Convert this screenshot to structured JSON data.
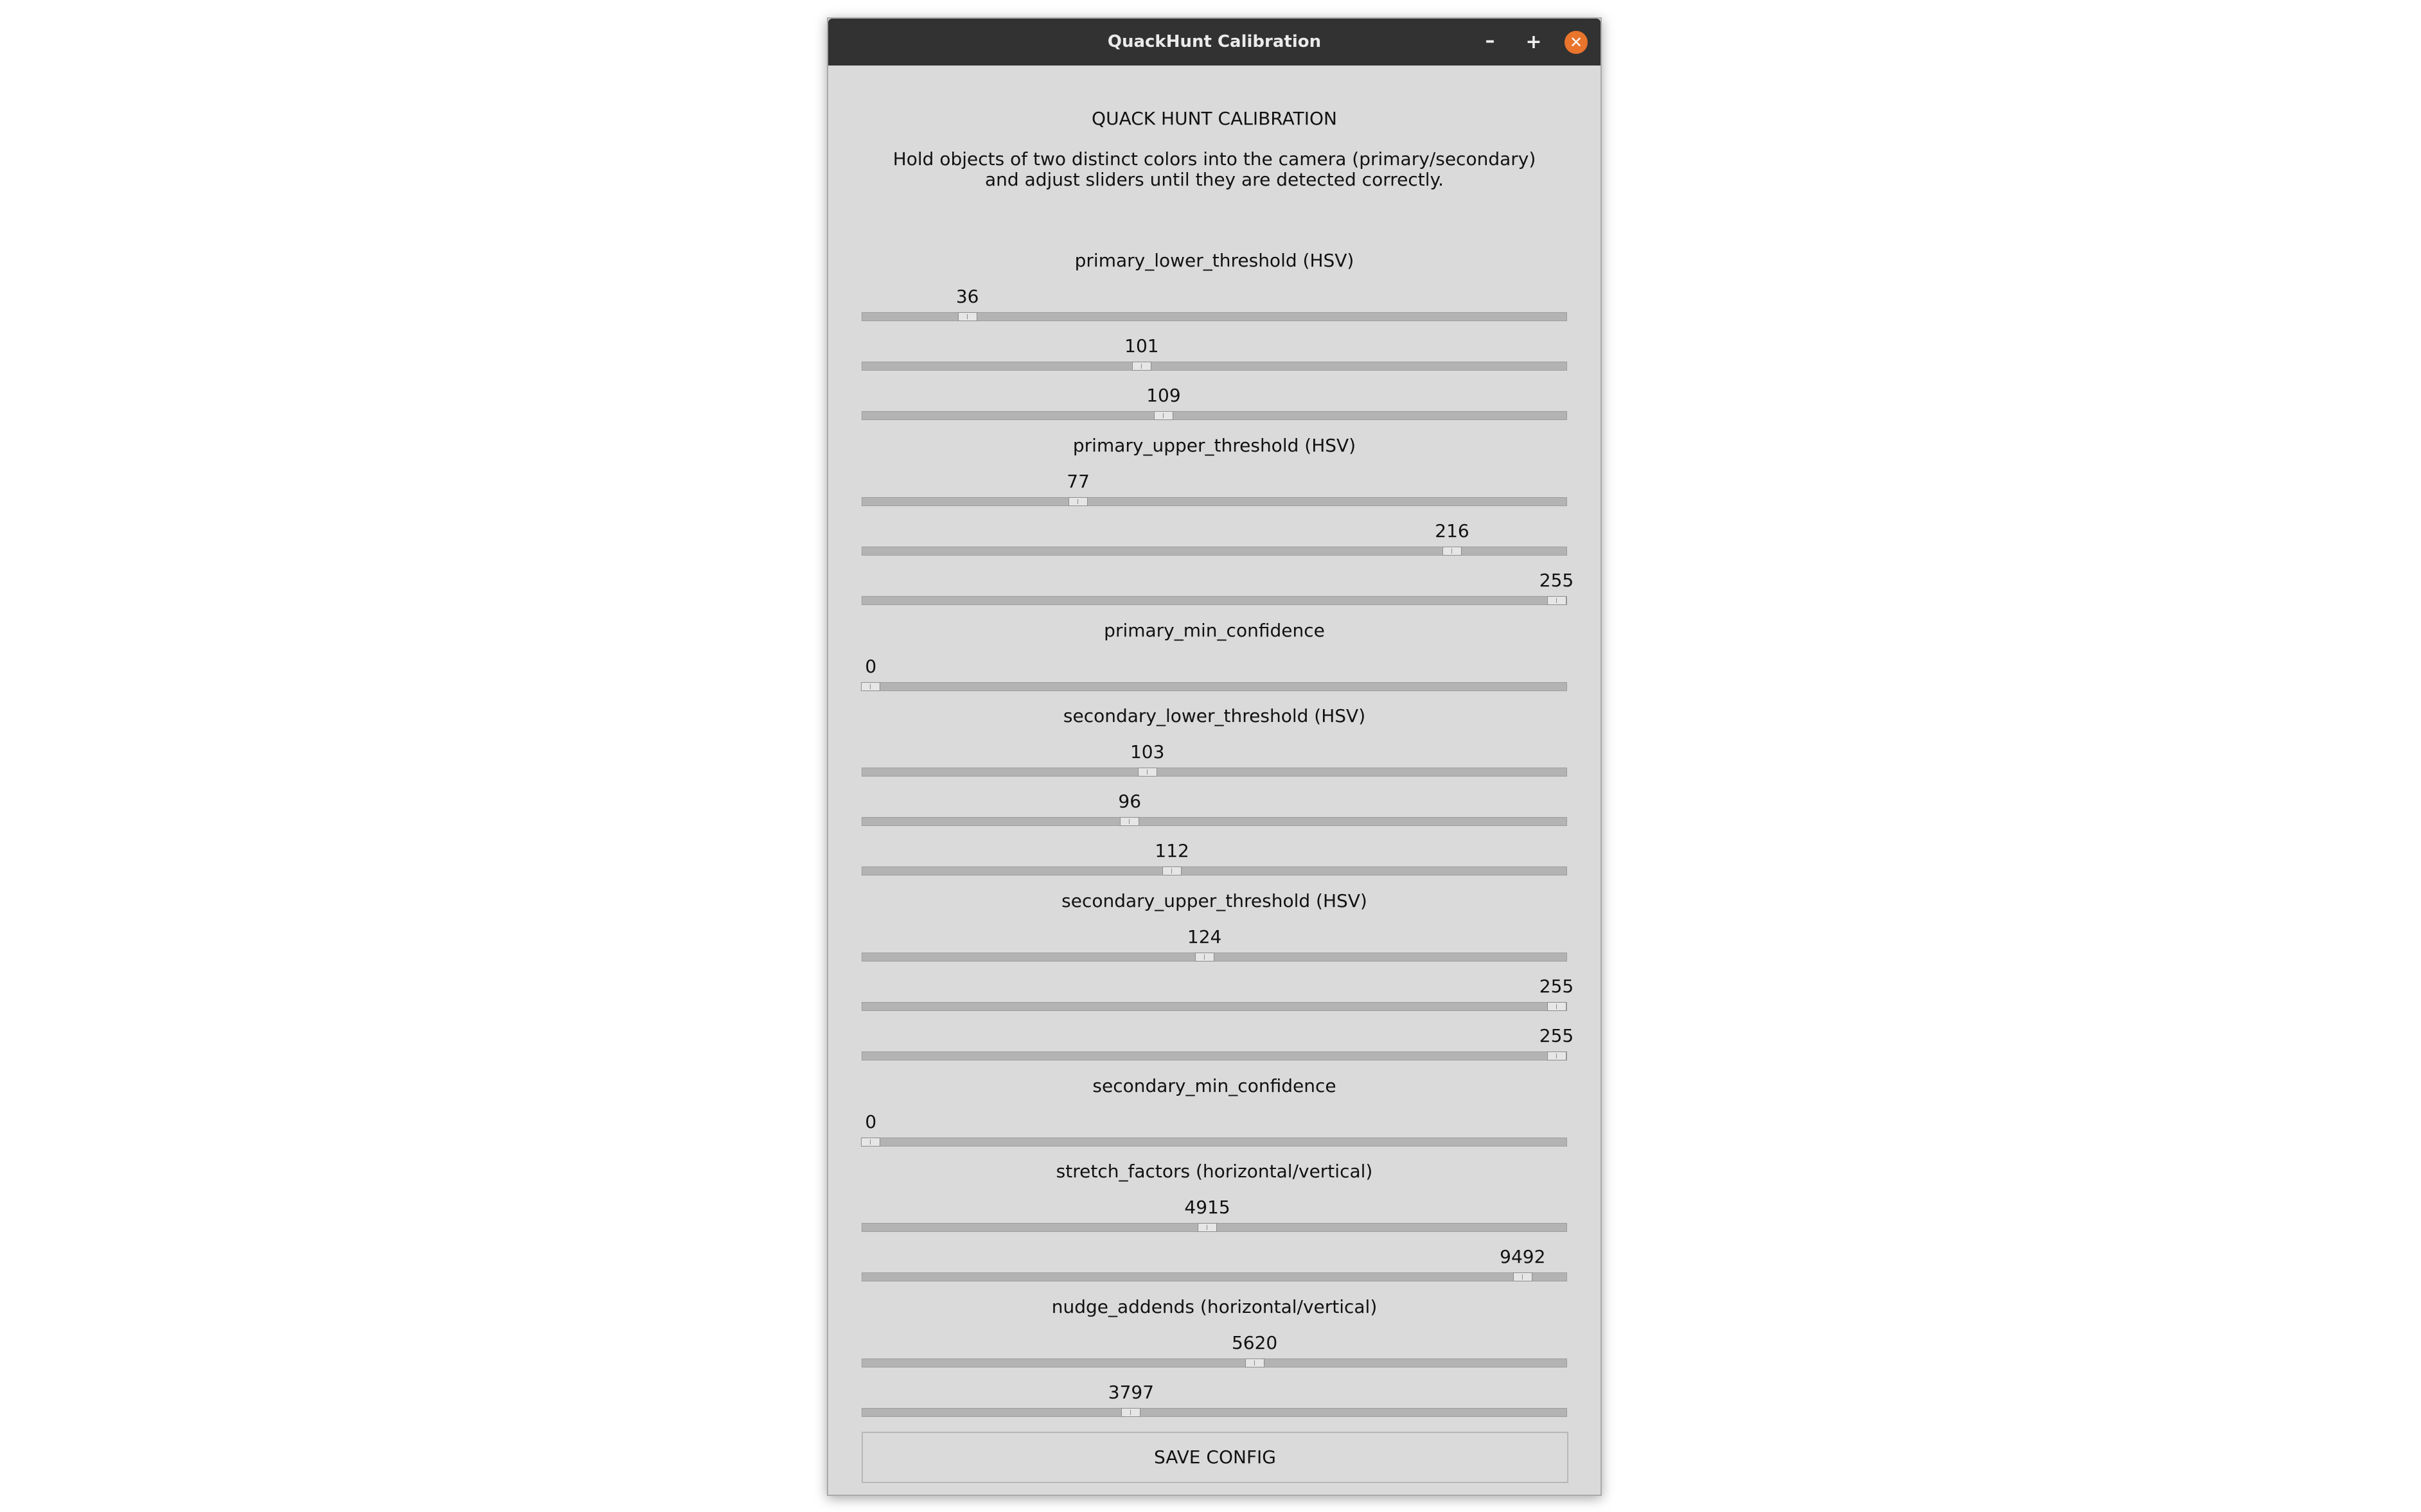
{
  "window": {
    "title": "QuackHunt Calibration",
    "minimize_glyph": "–",
    "maximize_glyph": "+",
    "close_glyph": "✕"
  },
  "main": {
    "heading": "QUACK HUNT CALIBRATION",
    "intro_line1": "Hold objects of two distinct colors into the camera (primary/secondary)",
    "intro_line2": "and adjust sliders until they are detected correctly.",
    "sections": [
      {
        "label": "primary_lower_threshold (HSV)",
        "sliders": [
          {
            "value": "36",
            "fraction": 0.15
          },
          {
            "value": "101",
            "fraction": 0.397
          },
          {
            "value": "109",
            "fraction": 0.428
          }
        ]
      },
      {
        "label": "primary_upper_threshold (HSV)",
        "sliders": [
          {
            "value": "77",
            "fraction": 0.307
          },
          {
            "value": "216",
            "fraction": 0.837
          },
          {
            "value": "255",
            "fraction": 0.985
          }
        ]
      },
      {
        "label": "primary_min_confidence",
        "sliders": [
          {
            "value": "0",
            "fraction": 0.013
          }
        ]
      },
      {
        "label": "secondary_lower_threshold (HSV)",
        "sliders": [
          {
            "value": "103",
            "fraction": 0.405
          },
          {
            "value": "96",
            "fraction": 0.38
          },
          {
            "value": "112",
            "fraction": 0.44
          }
        ]
      },
      {
        "label": "secondary_upper_threshold (HSV)",
        "sliders": [
          {
            "value": "124",
            "fraction": 0.486
          },
          {
            "value": "255",
            "fraction": 0.985
          },
          {
            "value": "255",
            "fraction": 0.985
          }
        ]
      },
      {
        "label": "secondary_min_confidence",
        "sliders": [
          {
            "value": "0",
            "fraction": 0.013
          }
        ]
      },
      {
        "label": "stretch_factors (horizontal/vertical)",
        "sliders": [
          {
            "value": "4915",
            "fraction": 0.49
          },
          {
            "value": "9492",
            "fraction": 0.937
          }
        ]
      },
      {
        "label": "nudge_addends (horizontal/vertical)",
        "sliders": [
          {
            "value": "5620",
            "fraction": 0.557
          },
          {
            "value": "3797",
            "fraction": 0.382
          }
        ]
      }
    ],
    "save_label": "SAVE CONFIG"
  },
  "colors": {
    "titlebar": "#323232",
    "window_bg": "#dadada",
    "close_button": "#e9742c",
    "trough": "#b3b3b3"
  }
}
